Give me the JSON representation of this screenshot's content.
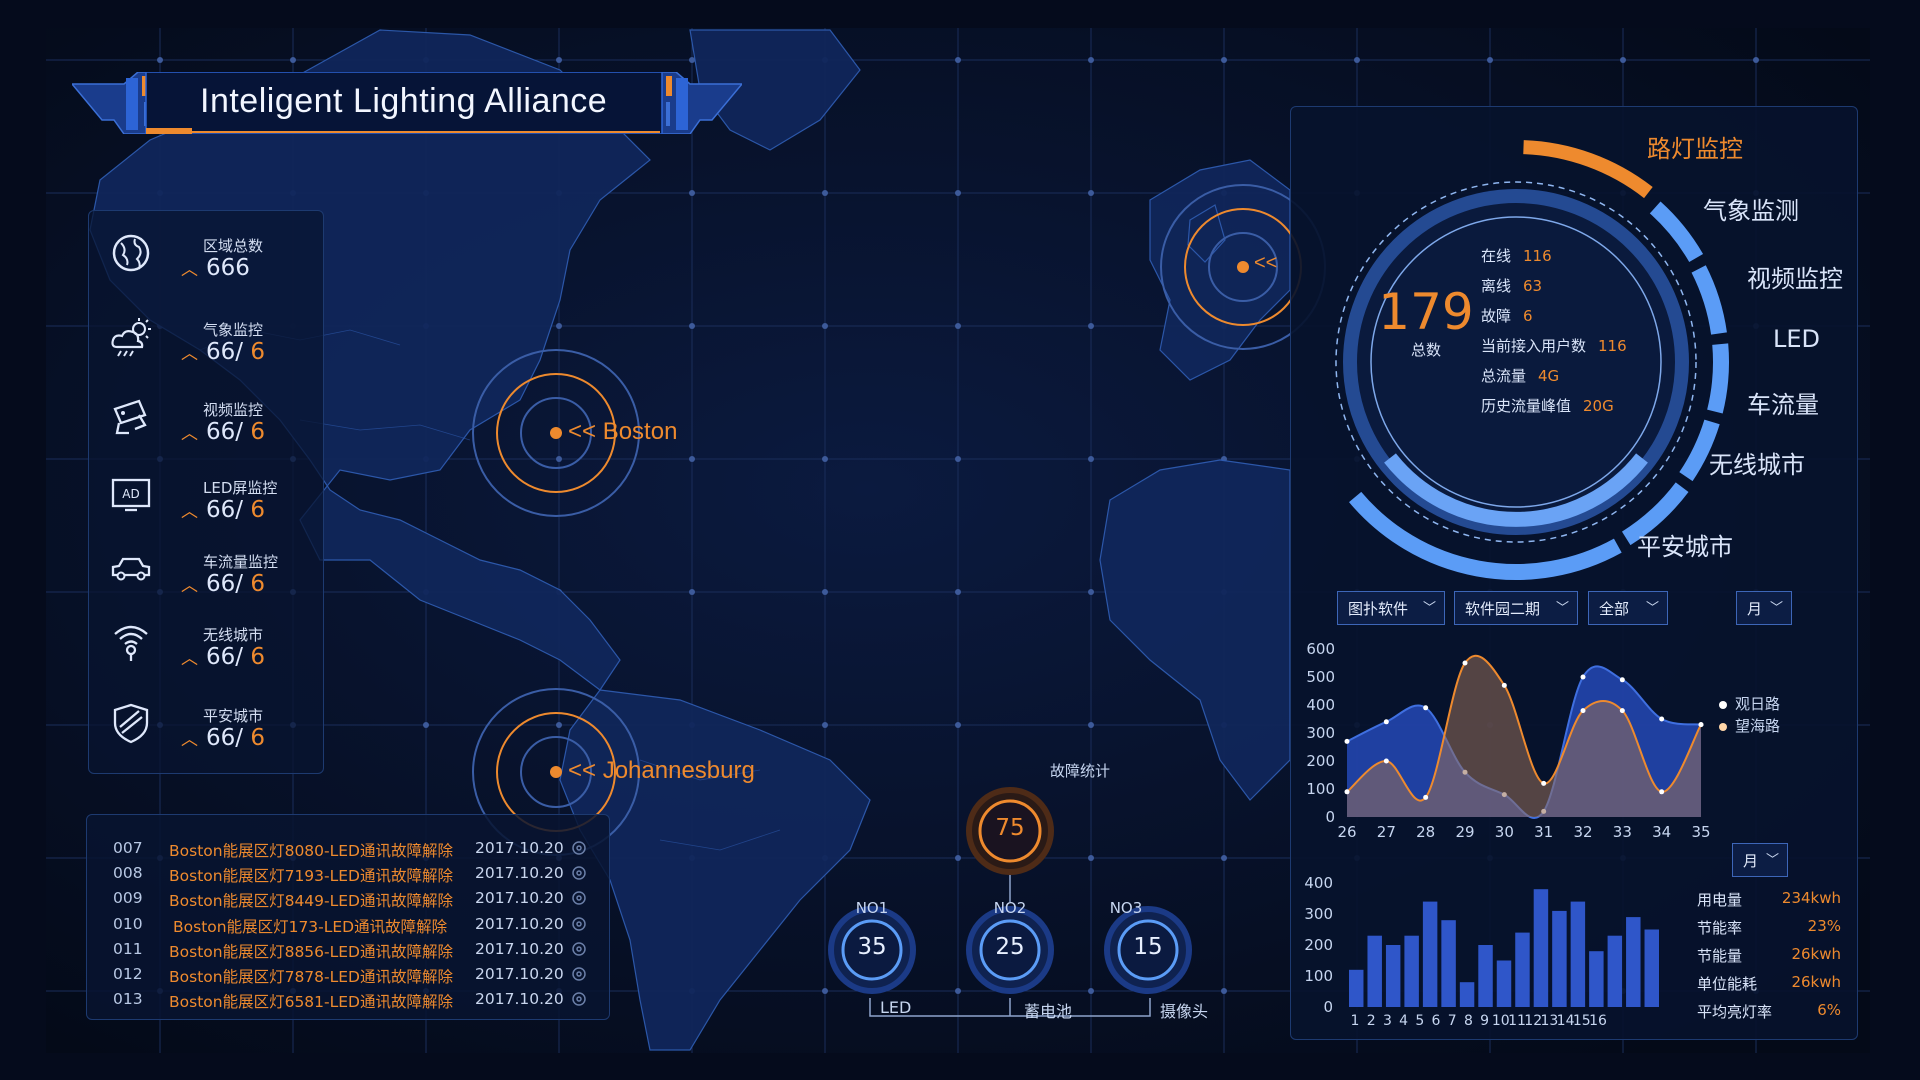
{
  "header": {
    "title": "Inteligent Lighting Alliance"
  },
  "stats": [
    {
      "label": "区域总数",
      "value": "666",
      "value2": "",
      "icon": "globe-icon"
    },
    {
      "label": "气象监控",
      "value": "66/",
      "value2": "6",
      "icon": "weather-icon"
    },
    {
      "label": "视频监控",
      "value": "66/",
      "value2": "6",
      "icon": "cctv-camera-icon"
    },
    {
      "label": "LED屏监控",
      "value": "66/",
      "value2": "6",
      "icon": "led-screen-icon"
    },
    {
      "label": "车流量监控",
      "value": "66/",
      "value2": "6",
      "icon": "car-icon"
    },
    {
      "label": "无线城市",
      "value": "66/",
      "value2": "6",
      "icon": "wifi-location-icon"
    },
    {
      "label": "平安城市",
      "value": "66/",
      "value2": "6",
      "icon": "shield-icon"
    }
  ],
  "map": {
    "markers": [
      {
        "name": "Boston",
        "label": "<< Boston"
      },
      {
        "name": "Johannesburg",
        "label": "<< Johannesburg"
      },
      {
        "name": "europe",
        "label": "<<"
      }
    ]
  },
  "fault_log": [
    {
      "id": "007",
      "msg": "Boston能展区灯8080-LED通讯故障解除",
      "date": "2017.10.20"
    },
    {
      "id": "008",
      "msg": "Boston能展区灯7193-LED通讯故障解除",
      "date": "2017.10.20"
    },
    {
      "id": "009",
      "msg": "Boston能展区灯8449-LED通讯故障解除",
      "date": "2017.10.20"
    },
    {
      "id": "010",
      "msg": "Boston能展区灯173-LED通讯故障解除",
      "date": "2017.10.20"
    },
    {
      "id": "011",
      "msg": "Boston能展区灯8856-LED通讯故障解除",
      "date": "2017.10.20"
    },
    {
      "id": "012",
      "msg": "Boston能展区灯7878-LED通讯故障解除",
      "date": "2017.10.20"
    },
    {
      "id": "013",
      "msg": "Boston能展区灯6581-LED通讯故障解除",
      "date": "2017.10.20"
    }
  ],
  "fault_stats": {
    "title": "故障统计",
    "total": "75",
    "items": [
      {
        "rank": "NO1",
        "value": "35",
        "label": "LED"
      },
      {
        "rank": "NO2",
        "value": "25",
        "label": "蓄电池"
      },
      {
        "rank": "NO3",
        "value": "15",
        "label": "摄像头"
      }
    ]
  },
  "ring": {
    "total": "179",
    "total_label": "总数",
    "details": [
      {
        "label": "在线",
        "value": "116"
      },
      {
        "label": "离线",
        "value": "63"
      },
      {
        "label": "故障",
        "value": "6"
      },
      {
        "label": "当前接入用户数",
        "value": "116"
      },
      {
        "label": "总流量",
        "value": "4G"
      },
      {
        "label": "历史流量峰值",
        "value": "20G"
      }
    ],
    "categories": [
      "路灯监控",
      "气象监测",
      "视频监控",
      "LED",
      "车流量",
      "无线城市",
      "平安城市"
    ],
    "active_category": "路灯监控",
    "colors": {
      "active": "#ee8a2e",
      "normal": "#5b9cf6"
    }
  },
  "filters": {
    "software": "图扑软件",
    "phase": "软件园二期",
    "scope": "全部",
    "period": "月",
    "period2": "月"
  },
  "chart_data": [
    {
      "type": "area",
      "x": [
        26,
        27,
        28,
        29,
        30,
        31,
        32,
        33,
        34,
        35
      ],
      "ylim": [
        0,
        600
      ],
      "yticks": [
        0,
        100,
        200,
        300,
        400,
        500,
        600
      ],
      "legend_position": "right",
      "series": [
        {
          "name": "观日路",
          "color": "#3f6fe0",
          "values": [
            270,
            340,
            390,
            160,
            80,
            20,
            500,
            490,
            350,
            330
          ]
        },
        {
          "name": "望海路",
          "color": "#ee8a2e",
          "values": [
            90,
            200,
            70,
            550,
            470,
            120,
            380,
            380,
            90,
            330
          ]
        }
      ]
    },
    {
      "type": "bar",
      "categories": [
        1,
        2,
        3,
        4,
        5,
        6,
        7,
        8,
        9,
        10,
        11,
        12,
        13,
        14,
        15,
        16
      ],
      "values": [
        120,
        230,
        200,
        230,
        340,
        280,
        80,
        200,
        150,
        240,
        380,
        310,
        340,
        180,
        230,
        290,
        250
      ],
      "ylim": [
        0,
        400
      ],
      "yticks": [
        0,
        100,
        200,
        300,
        400
      ],
      "color": "#2f56c9"
    }
  ],
  "energy": [
    {
      "label": "用电量",
      "value": "234kwh"
    },
    {
      "label": "节能率",
      "value": "23%"
    },
    {
      "label": "节能量",
      "value": "26kwh"
    },
    {
      "label": "单位能耗",
      "value": "26kwh"
    },
    {
      "label": "平均亮灯率",
      "value": "6%"
    }
  ]
}
